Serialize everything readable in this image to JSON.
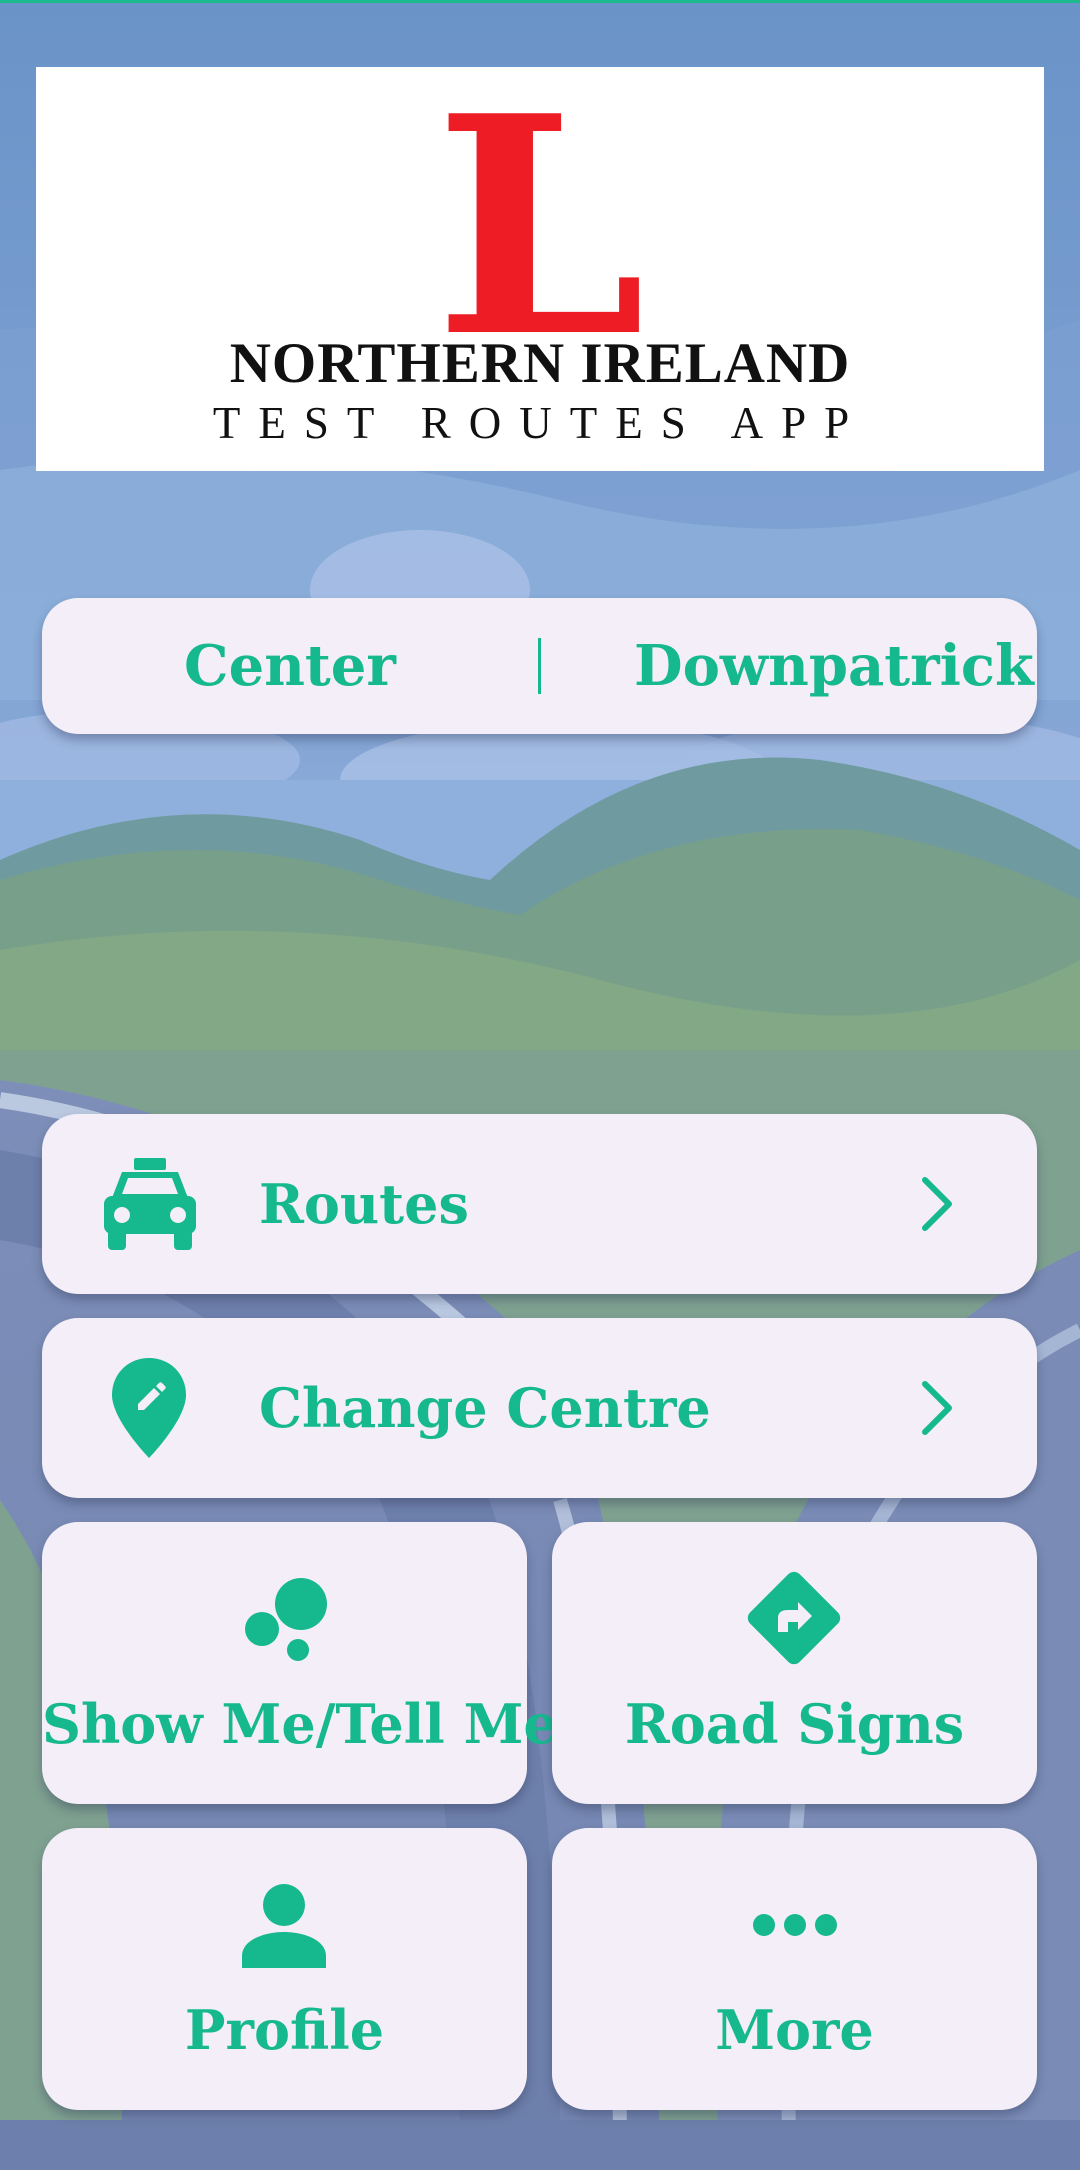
{
  "logo": {
    "letter": "L",
    "title": "NORTHERN IRELAND",
    "subtitle": "TEST ROUTES APP"
  },
  "center_selector": {
    "label": "Center",
    "value": "Downpatrick"
  },
  "menu": {
    "routes": {
      "label": "Routes",
      "icon": "car-icon"
    },
    "change_centre": {
      "label": "Change Centre",
      "icon": "map-pin-edit-icon"
    },
    "show_me_tell_me": {
      "label": "Show Me/Tell Me",
      "icon": "bubbles-icon"
    },
    "road_signs": {
      "label": "Road Signs",
      "icon": "turn-sign-icon"
    },
    "profile": {
      "label": "Profile",
      "icon": "person-icon"
    },
    "more": {
      "label": "More",
      "icon": "more-dots-icon"
    }
  },
  "colors": {
    "accent": "#16b88e",
    "logo_red": "#ee1c25",
    "card_bg": "#f3eef7"
  }
}
